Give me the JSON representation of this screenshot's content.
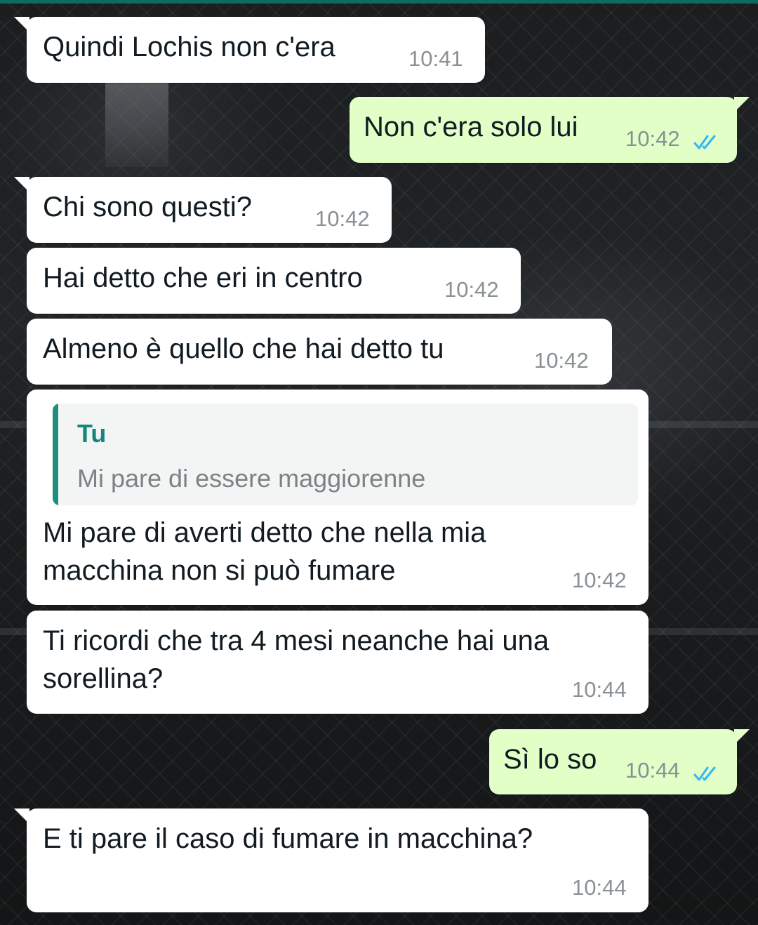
{
  "conversation": {
    "messages": [
      {
        "text": "Quindi Lochis non c'era",
        "time": "10:41"
      },
      {
        "text": "Non c'era solo lui",
        "time": "10:42"
      },
      {
        "text": "Chi sono questi?",
        "time": "10:42"
      },
      {
        "text": "Hai detto che eri in centro",
        "time": "10:42"
      },
      {
        "text": "Almeno è quello che hai detto tu",
        "time": "10:42"
      },
      {
        "quote_author": "Tu",
        "quote_text": "Mi pare di essere maggiorenne",
        "line1": "Mi pare di averti detto che nella mia",
        "line2": "macchina non si può fumare",
        "time": "10:42"
      },
      {
        "line1": "Ti ricordi che tra 4 mesi neanche hai una",
        "line2": "sorellina?",
        "time": "10:44"
      },
      {
        "text": "Sì lo so",
        "time": "10:44"
      },
      {
        "text": "E ti pare il caso di fumare in macchina?",
        "time": "10:44"
      }
    ]
  },
  "colors": {
    "incoming_bubble": "#ffffff",
    "outgoing_bubble": "#e1ffc7",
    "read_ticks": "#34b7f1",
    "quote_accent": "#1f8f7d",
    "header_strip": "#0f6b5e"
  },
  "icons": {
    "read_receipt": "double-check-icon"
  }
}
